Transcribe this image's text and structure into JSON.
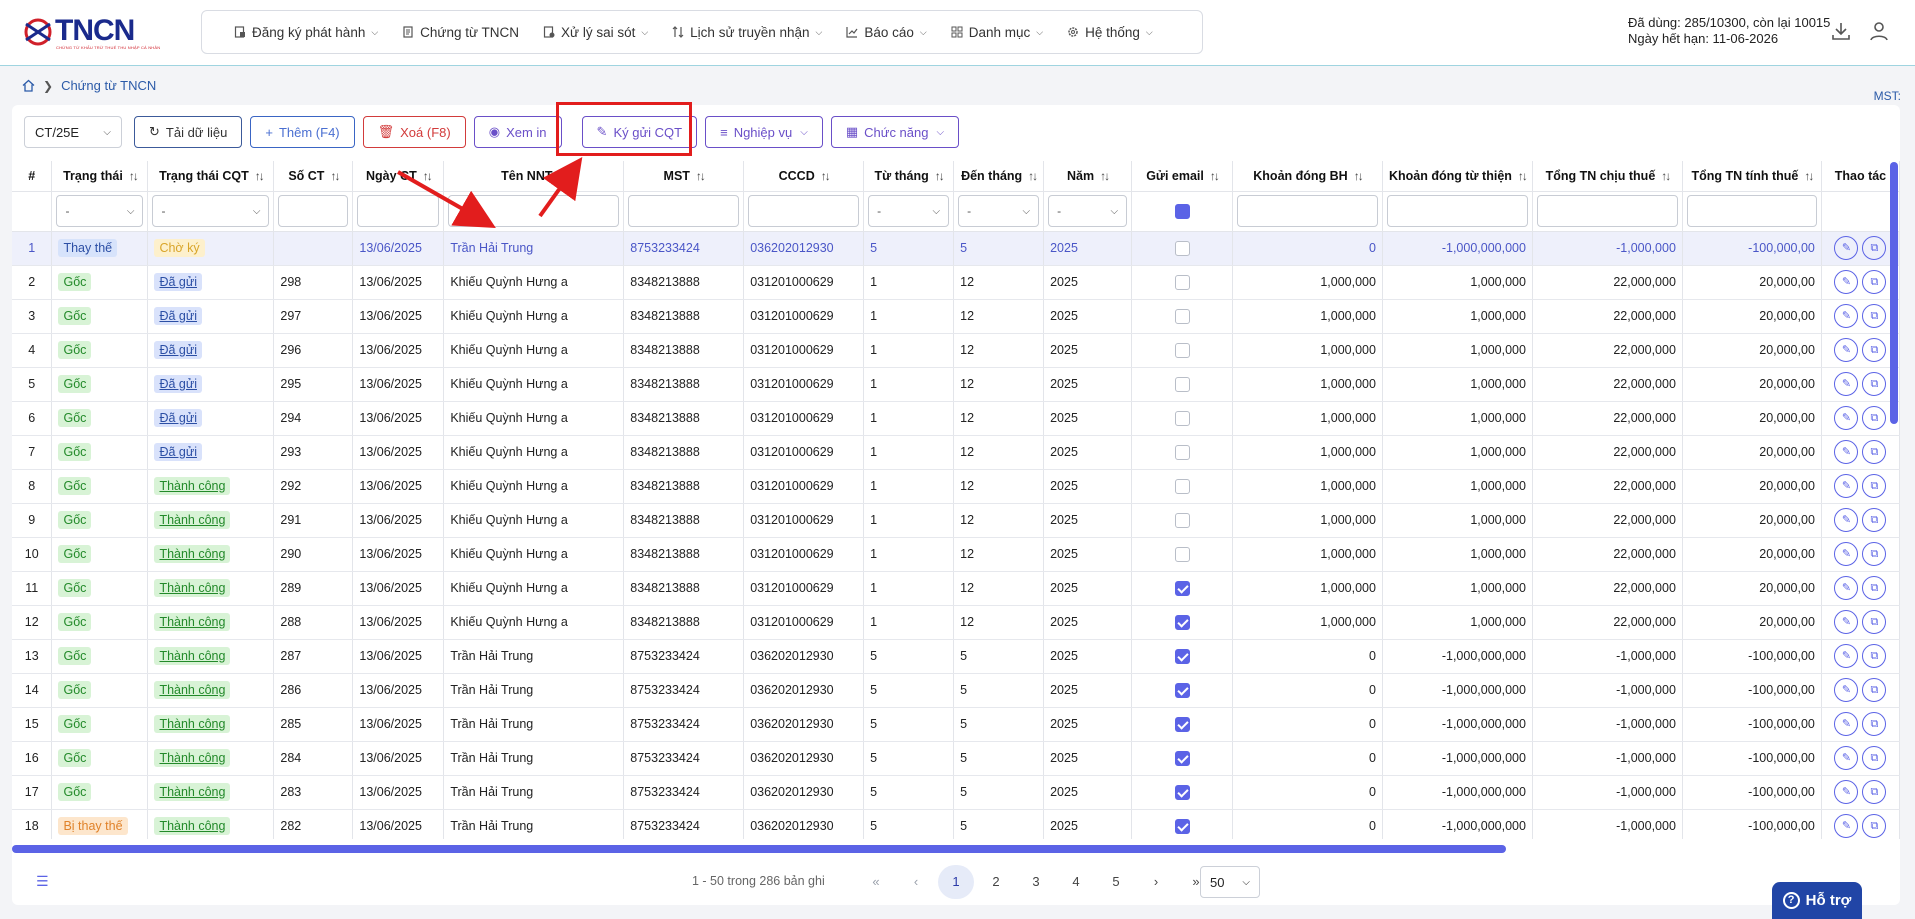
{
  "app": {
    "logo_text": "TNCN",
    "logo_sub": "CHỨNG TỪ KHẤU TRỪ THUẾ THU NHẬP CÁ NHÂN",
    "quota_line1": "Đã dùng: 285/10300, còn lại 10015",
    "quota_line2": "Ngày hết hạn: 11-06-2026"
  },
  "nav": [
    {
      "label": "Đăng ký phát hành",
      "icon": "file-register-icon",
      "dropdown": true
    },
    {
      "label": "Chứng từ TNCN",
      "icon": "document-icon",
      "dropdown": false
    },
    {
      "label": "Xử lý sai sót",
      "icon": "file-error-icon",
      "dropdown": true
    },
    {
      "label": "Lịch sử truyền nhận",
      "icon": "transfer-icon",
      "dropdown": true
    },
    {
      "label": "Báo cáo",
      "icon": "chart-icon",
      "dropdown": true
    },
    {
      "label": "Danh mục",
      "icon": "grid-icon",
      "dropdown": true
    },
    {
      "label": "Hệ thống",
      "icon": "gear-icon",
      "dropdown": true
    }
  ],
  "breadcrumb": {
    "current": "Chứng từ TNCN"
  },
  "mst_label": "MST:",
  "toolbar": {
    "template_value": "CT/25E",
    "reload": "Tải dữ liệu",
    "add": "Thêm (F4)",
    "delete": "Xoá (F8)",
    "preview": "Xem in",
    "sign": "Ký gửi CQT",
    "operations": "Nghiệp vụ",
    "functions": "Chức năng"
  },
  "columns": [
    "#",
    "Trạng thái",
    "Trạng thái CQT",
    "Số CT",
    "Ngày CT",
    "Tên NNT",
    "MST",
    "CCCD",
    "Từ tháng",
    "Đến tháng",
    "Năm",
    "Gửi email",
    "Khoản đóng BH",
    "Khoản đóng từ thiện",
    "Tổng TN chịu thuế",
    "Tổng TN tính thuế",
    "Thao tác"
  ],
  "filter_placeholder": "-",
  "rows": [
    {
      "idx": "1",
      "status": "Thay thế",
      "status_type": "thay",
      "cqt": "Chờ ký",
      "cqt_type": "cho",
      "so_ct": "",
      "ngay": "13/06/2025",
      "ten": "Trần Hải Trung",
      "mst": "8753233424",
      "cccd": "036202012930",
      "tu": "5",
      "den": "5",
      "nam": "2025",
      "email": false,
      "bh": "0",
      "tuthien": "-1,000,000,000",
      "chiu": "-1,000,000",
      "tinh": "-100,000,00",
      "hl": true
    },
    {
      "idx": "2",
      "status": "Gốc",
      "status_type": "goc",
      "cqt": "Đã gửi",
      "cqt_type": "dagui",
      "so_ct": "298",
      "ngay": "13/06/2025",
      "ten": "Khiếu Quỳnh Hưng a",
      "mst": "8348213888",
      "cccd": "031201000629",
      "tu": "1",
      "den": "12",
      "nam": "2025",
      "email": false,
      "bh": "1,000,000",
      "tuthien": "1,000,000",
      "chiu": "22,000,000",
      "tinh": "20,000,00"
    },
    {
      "idx": "3",
      "status": "Gốc",
      "status_type": "goc",
      "cqt": "Đã gửi",
      "cqt_type": "dagui",
      "so_ct": "297",
      "ngay": "13/06/2025",
      "ten": "Khiếu Quỳnh Hưng a",
      "mst": "8348213888",
      "cccd": "031201000629",
      "tu": "1",
      "den": "12",
      "nam": "2025",
      "email": false,
      "bh": "1,000,000",
      "tuthien": "1,000,000",
      "chiu": "22,000,000",
      "tinh": "20,000,00"
    },
    {
      "idx": "4",
      "status": "Gốc",
      "status_type": "goc",
      "cqt": "Đã gửi",
      "cqt_type": "dagui",
      "so_ct": "296",
      "ngay": "13/06/2025",
      "ten": "Khiếu Quỳnh Hưng a",
      "mst": "8348213888",
      "cccd": "031201000629",
      "tu": "1",
      "den": "12",
      "nam": "2025",
      "email": false,
      "bh": "1,000,000",
      "tuthien": "1,000,000",
      "chiu": "22,000,000",
      "tinh": "20,000,00"
    },
    {
      "idx": "5",
      "status": "Gốc",
      "status_type": "goc",
      "cqt": "Đã gửi",
      "cqt_type": "dagui",
      "so_ct": "295",
      "ngay": "13/06/2025",
      "ten": "Khiếu Quỳnh Hưng a",
      "mst": "8348213888",
      "cccd": "031201000629",
      "tu": "1",
      "den": "12",
      "nam": "2025",
      "email": false,
      "bh": "1,000,000",
      "tuthien": "1,000,000",
      "chiu": "22,000,000",
      "tinh": "20,000,00"
    },
    {
      "idx": "6",
      "status": "Gốc",
      "status_type": "goc",
      "cqt": "Đã gửi",
      "cqt_type": "dagui",
      "so_ct": "294",
      "ngay": "13/06/2025",
      "ten": "Khiếu Quỳnh Hưng a",
      "mst": "8348213888",
      "cccd": "031201000629",
      "tu": "1",
      "den": "12",
      "nam": "2025",
      "email": false,
      "bh": "1,000,000",
      "tuthien": "1,000,000",
      "chiu": "22,000,000",
      "tinh": "20,000,00"
    },
    {
      "idx": "7",
      "status": "Gốc",
      "status_type": "goc",
      "cqt": "Đã gửi",
      "cqt_type": "dagui",
      "so_ct": "293",
      "ngay": "13/06/2025",
      "ten": "Khiếu Quỳnh Hưng a",
      "mst": "8348213888",
      "cccd": "031201000629",
      "tu": "1",
      "den": "12",
      "nam": "2025",
      "email": false,
      "bh": "1,000,000",
      "tuthien": "1,000,000",
      "chiu": "22,000,000",
      "tinh": "20,000,00"
    },
    {
      "idx": "8",
      "status": "Gốc",
      "status_type": "goc",
      "cqt": "Thành công",
      "cqt_type": "tc",
      "so_ct": "292",
      "ngay": "13/06/2025",
      "ten": "Khiếu Quỳnh Hưng a",
      "mst": "8348213888",
      "cccd": "031201000629",
      "tu": "1",
      "den": "12",
      "nam": "2025",
      "email": false,
      "bh": "1,000,000",
      "tuthien": "1,000,000",
      "chiu": "22,000,000",
      "tinh": "20,000,00"
    },
    {
      "idx": "9",
      "status": "Gốc",
      "status_type": "goc",
      "cqt": "Thành công",
      "cqt_type": "tc",
      "so_ct": "291",
      "ngay": "13/06/2025",
      "ten": "Khiếu Quỳnh Hưng a",
      "mst": "8348213888",
      "cccd": "031201000629",
      "tu": "1",
      "den": "12",
      "nam": "2025",
      "email": false,
      "bh": "1,000,000",
      "tuthien": "1,000,000",
      "chiu": "22,000,000",
      "tinh": "20,000,00"
    },
    {
      "idx": "10",
      "status": "Gốc",
      "status_type": "goc",
      "cqt": "Thành công",
      "cqt_type": "tc",
      "so_ct": "290",
      "ngay": "13/06/2025",
      "ten": "Khiếu Quỳnh Hưng a",
      "mst": "8348213888",
      "cccd": "031201000629",
      "tu": "1",
      "den": "12",
      "nam": "2025",
      "email": false,
      "bh": "1,000,000",
      "tuthien": "1,000,000",
      "chiu": "22,000,000",
      "tinh": "20,000,00"
    },
    {
      "idx": "11",
      "status": "Gốc",
      "status_type": "goc",
      "cqt": "Thành công",
      "cqt_type": "tc",
      "so_ct": "289",
      "ngay": "13/06/2025",
      "ten": "Khiếu Quỳnh Hưng a",
      "mst": "8348213888",
      "cccd": "031201000629",
      "tu": "1",
      "den": "12",
      "nam": "2025",
      "email": true,
      "bh": "1,000,000",
      "tuthien": "1,000,000",
      "chiu": "22,000,000",
      "tinh": "20,000,00"
    },
    {
      "idx": "12",
      "status": "Gốc",
      "status_type": "goc",
      "cqt": "Thành công",
      "cqt_type": "tc",
      "so_ct": "288",
      "ngay": "13/06/2025",
      "ten": "Khiếu Quỳnh Hưng a",
      "mst": "8348213888",
      "cccd": "031201000629",
      "tu": "1",
      "den": "12",
      "nam": "2025",
      "email": true,
      "bh": "1,000,000",
      "tuthien": "1,000,000",
      "chiu": "22,000,000",
      "tinh": "20,000,00"
    },
    {
      "idx": "13",
      "status": "Gốc",
      "status_type": "goc",
      "cqt": "Thành công",
      "cqt_type": "tc",
      "so_ct": "287",
      "ngay": "13/06/2025",
      "ten": "Trần Hải Trung",
      "mst": "8753233424",
      "cccd": "036202012930",
      "tu": "5",
      "den": "5",
      "nam": "2025",
      "email": true,
      "bh": "0",
      "tuthien": "-1,000,000,000",
      "chiu": "-1,000,000",
      "tinh": "-100,000,00"
    },
    {
      "idx": "14",
      "status": "Gốc",
      "status_type": "goc",
      "cqt": "Thành công",
      "cqt_type": "tc",
      "so_ct": "286",
      "ngay": "13/06/2025",
      "ten": "Trần Hải Trung",
      "mst": "8753233424",
      "cccd": "036202012930",
      "tu": "5",
      "den": "5",
      "nam": "2025",
      "email": true,
      "bh": "0",
      "tuthien": "-1,000,000,000",
      "chiu": "-1,000,000",
      "tinh": "-100,000,00"
    },
    {
      "idx": "15",
      "status": "Gốc",
      "status_type": "goc",
      "cqt": "Thành công",
      "cqt_type": "tc",
      "so_ct": "285",
      "ngay": "13/06/2025",
      "ten": "Trần Hải Trung",
      "mst": "8753233424",
      "cccd": "036202012930",
      "tu": "5",
      "den": "5",
      "nam": "2025",
      "email": true,
      "bh": "0",
      "tuthien": "-1,000,000,000",
      "chiu": "-1,000,000",
      "tinh": "-100,000,00"
    },
    {
      "idx": "16",
      "status": "Gốc",
      "status_type": "goc",
      "cqt": "Thành công",
      "cqt_type": "tc",
      "so_ct": "284",
      "ngay": "13/06/2025",
      "ten": "Trần Hải Trung",
      "mst": "8753233424",
      "cccd": "036202012930",
      "tu": "5",
      "den": "5",
      "nam": "2025",
      "email": true,
      "bh": "0",
      "tuthien": "-1,000,000,000",
      "chiu": "-1,000,000",
      "tinh": "-100,000,00"
    },
    {
      "idx": "17",
      "status": "Gốc",
      "status_type": "goc",
      "cqt": "Thành công",
      "cqt_type": "tc",
      "so_ct": "283",
      "ngay": "13/06/2025",
      "ten": "Trần Hải Trung",
      "mst": "8753233424",
      "cccd": "036202012930",
      "tu": "5",
      "den": "5",
      "nam": "2025",
      "email": true,
      "bh": "0",
      "tuthien": "-1,000,000,000",
      "chiu": "-1,000,000",
      "tinh": "-100,000,00"
    },
    {
      "idx": "18",
      "status": "Bị thay thế",
      "status_type": "bithay",
      "cqt": "Thành công",
      "cqt_type": "tc",
      "so_ct": "282",
      "ngay": "13/06/2025",
      "ten": "Trần Hải Trung",
      "mst": "8753233424",
      "cccd": "036202012930",
      "tu": "5",
      "den": "5",
      "nam": "2025",
      "email": true,
      "bh": "0",
      "tuthien": "-1,000,000,000",
      "chiu": "-1,000,000",
      "tinh": "-100,000,00"
    }
  ],
  "pagination": {
    "info": "1 - 50 trong 286 bản ghi",
    "pages": [
      "1",
      "2",
      "3",
      "4",
      "5"
    ],
    "current": "1",
    "page_size": "50"
  },
  "help_label": "Hỗ trợ",
  "colors": {
    "accent": "#5b63e6",
    "annotation": "#e21d1d",
    "brand": "#1a2a8c"
  }
}
